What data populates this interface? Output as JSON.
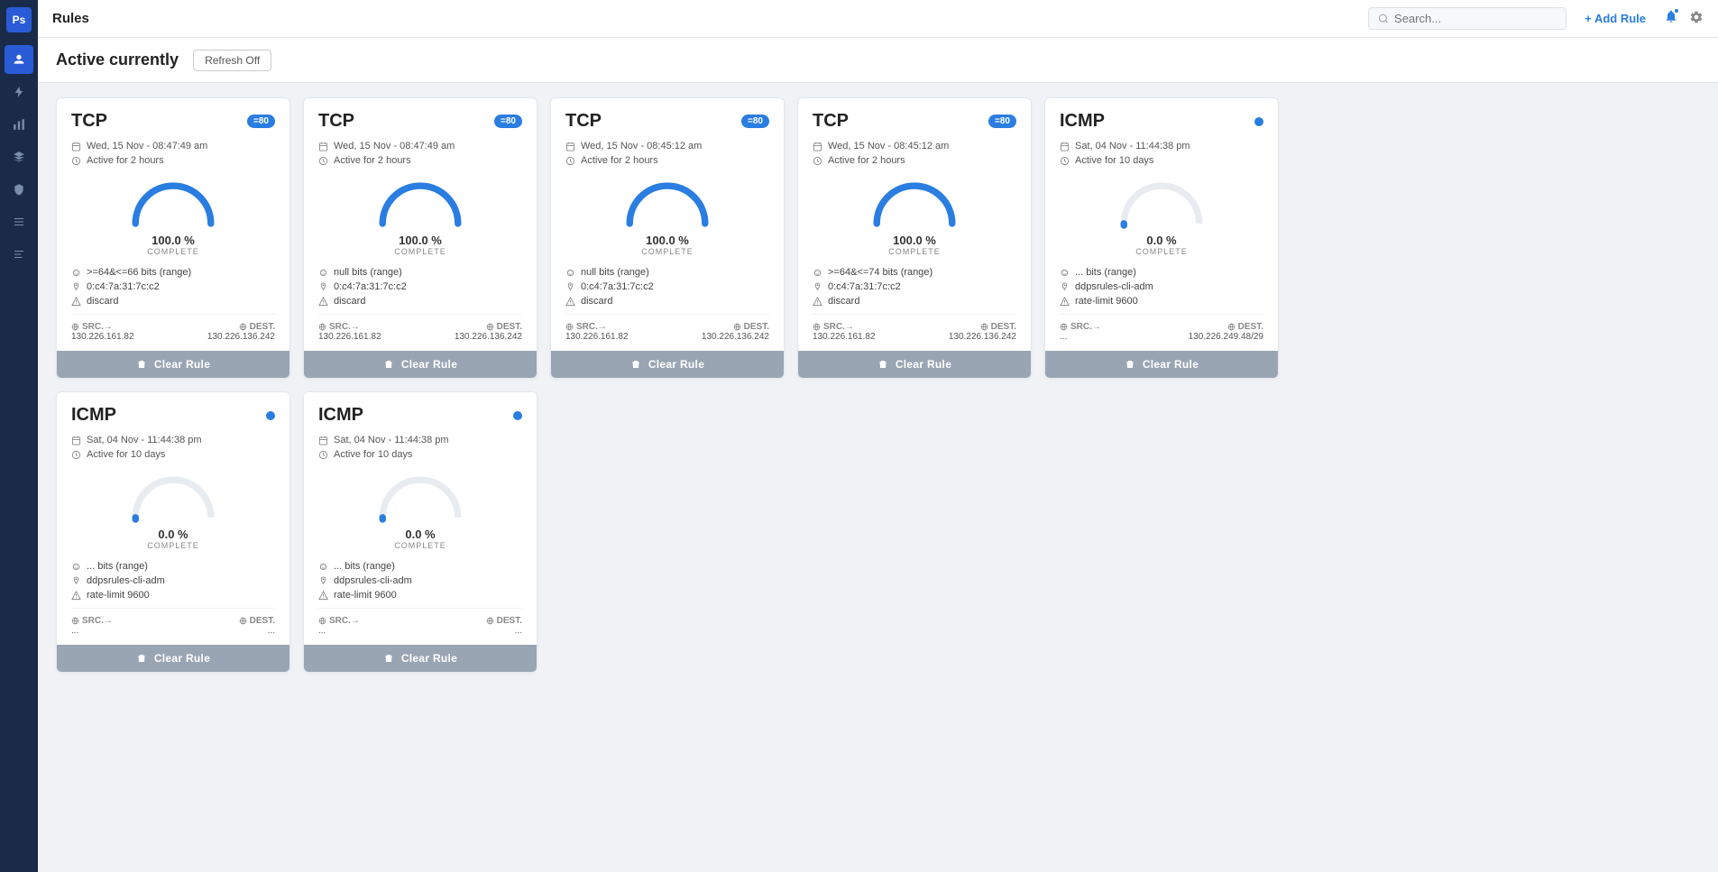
{
  "topbar": {
    "title": "Rules",
    "search_placeholder": "Search...",
    "add_rule_label": "+ Add Rule"
  },
  "page": {
    "header": "Active currently",
    "refresh_label": "Refresh Off"
  },
  "cards_row1": [
    {
      "protocol": "TCP",
      "badge": "=80",
      "badge_type": "blue",
      "date": "Wed, 15 Nov - 08:47:49 am",
      "active": "Active for 2 hours",
      "gauge_pct": "100.0",
      "gauge_label": "COMPLETE",
      "bits": ">=64&<=66 bits (range)",
      "mac": "0:c4:7a:31:7c:c2",
      "action": "discard",
      "src_label": "SRC.→",
      "src_val": "130.226.161.82",
      "dest_label": "DEST.",
      "dest_val": "130.226.136.242",
      "clear_label": "Clear Rule",
      "filled": true
    },
    {
      "protocol": "TCP",
      "badge": "=80",
      "badge_type": "blue",
      "date": "Wed, 15 Nov - 08:47:49 am",
      "active": "Active for 2 hours",
      "gauge_pct": "100.0",
      "gauge_label": "COMPLETE",
      "bits": "null bits (range)",
      "mac": "0:c4:7a:31:7c:c2",
      "action": "discard",
      "src_label": "SRC.→",
      "src_val": "130.226.161.82",
      "dest_label": "DEST.",
      "dest_val": "130.226.136.242",
      "clear_label": "Clear Rule",
      "filled": true
    },
    {
      "protocol": "TCP",
      "badge": "=80",
      "badge_type": "blue",
      "date": "Wed, 15 Nov - 08:45:12 am",
      "active": "Active for 2 hours",
      "gauge_pct": "100.0",
      "gauge_label": "COMPLETE",
      "bits": "null bits (range)",
      "mac": "0:c4:7a:31:7c:c2",
      "action": "discard",
      "src_label": "SRC.→",
      "src_val": "130.226.161.82",
      "dest_label": "DEST.",
      "dest_val": "130.226.136.242",
      "clear_label": "Clear Rule",
      "filled": true
    },
    {
      "protocol": "TCP",
      "badge": "=80",
      "badge_type": "blue",
      "date": "Wed, 15 Nov - 08:45:12 am",
      "active": "Active for 2 hours",
      "gauge_pct": "100.0",
      "gauge_label": "COMPLETE",
      "bits": ">=64&<=74 bits (range)",
      "mac": "0:c4:7a:31:7c:c2",
      "action": "discard",
      "src_label": "SRC.→",
      "src_val": "130.226.161.82",
      "dest_label": "DEST.",
      "dest_val": "130.226.136.242",
      "clear_label": "Clear Rule",
      "filled": true
    },
    {
      "protocol": "ICMP",
      "badge": "",
      "badge_type": "dot",
      "date": "Sat, 04 Nov - 11:44:38 pm",
      "active": "Active for 10 days",
      "gauge_pct": "0.0",
      "gauge_label": "COMPLETE",
      "bits": "... bits (range)",
      "mac": "ddpsrules-cli-adm",
      "action": "rate-limit 9600",
      "src_label": "SRC.→",
      "src_val": "...",
      "dest_label": "DEST.",
      "dest_val": "130.226.249.48/29",
      "clear_label": "Clear Rule",
      "filled": false
    }
  ],
  "cards_row2": [
    {
      "protocol": "ICMP",
      "badge": "",
      "badge_type": "dot",
      "date": "Sat, 04 Nov - 11:44:38 pm",
      "active": "Active for 10 days",
      "gauge_pct": "0.0",
      "gauge_label": "COMPLETE",
      "bits": "... bits (range)",
      "mac": "ddpsrules-cli-adm",
      "action": "rate-limit 9600",
      "src_label": "SRC.→",
      "src_val": "...",
      "dest_label": "DEST.",
      "dest_val": "...",
      "clear_label": "Clear Rule",
      "filled": false
    },
    {
      "protocol": "ICMP",
      "badge": "",
      "badge_type": "dot",
      "date": "Sat, 04 Nov - 11:44:38 pm",
      "active": "Active for 10 days",
      "gauge_pct": "0.0",
      "gauge_label": "COMPLETE",
      "bits": "... bits (range)",
      "mac": "ddpsrules-cli-adm",
      "action": "rate-limit 9600",
      "src_label": "SRC.→",
      "src_val": "...",
      "dest_label": "DEST.",
      "dest_val": "...",
      "clear_label": "Clear Rule",
      "filled": false
    }
  ],
  "sidebar": {
    "logo": "Ps",
    "icons": [
      "👤",
      "⚡",
      "📊",
      "📦",
      "🛡",
      "≡",
      "☰"
    ]
  }
}
